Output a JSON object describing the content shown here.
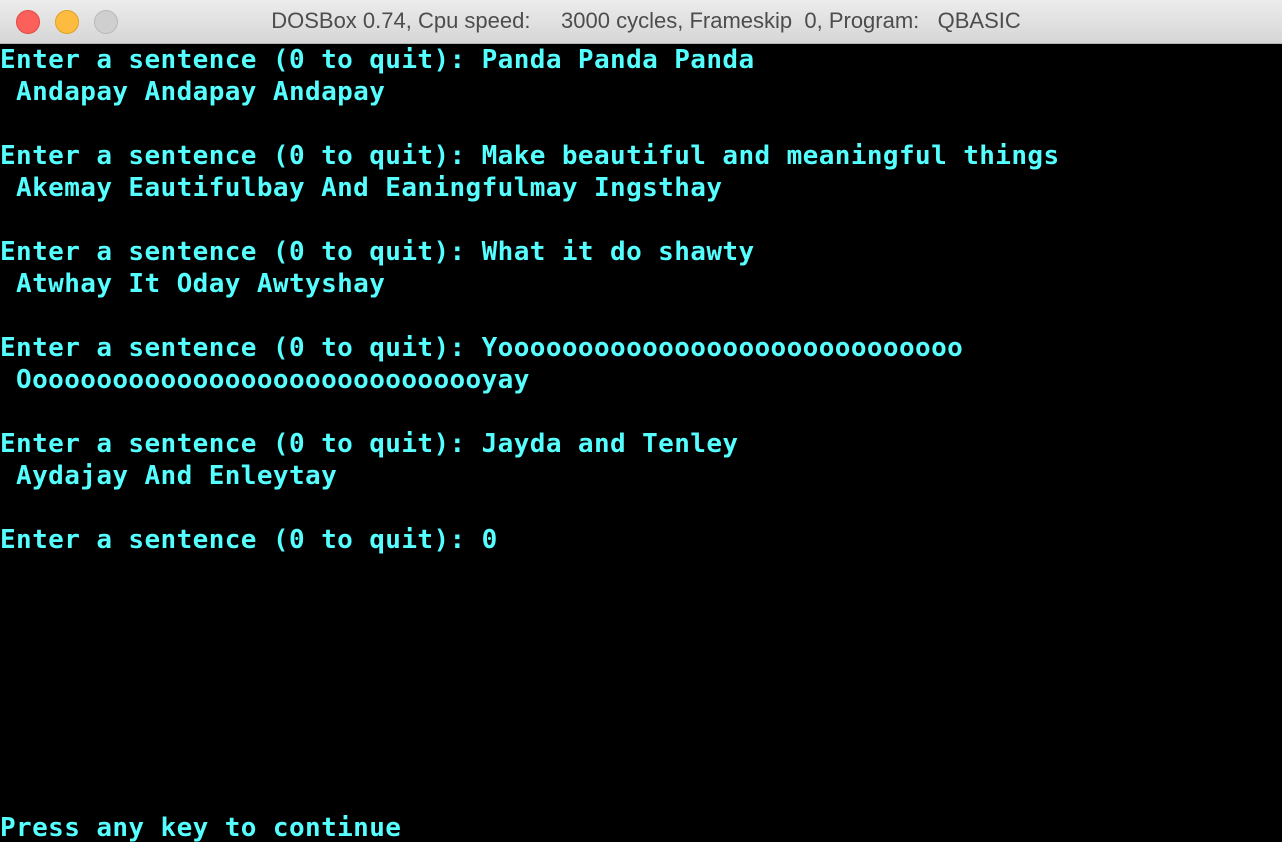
{
  "window": {
    "title": "DOSBox 0.74, Cpu speed:     3000 cycles, Frameskip  0, Program:   QBASIC"
  },
  "console": {
    "lines": [
      "Enter a sentence (0 to quit): Panda Panda Panda",
      " Andapay Andapay Andapay",
      "Enter a sentence (0 to quit): Make beautiful and meaningful things",
      " Akemay Eautifulbay And Eaningfulmay Ingsthay",
      "Enter a sentence (0 to quit): What it do shawty",
      " Atwhay It Oday Awtyshay",
      "Enter a sentence (0 to quit): Yooooooooooooooooooooooooooooo",
      " Oooooooooooooooooooooooooooooyay",
      "Enter a sentence (0 to quit): Jayda and Tenley",
      " Aydajay And Enleytay",
      "Enter a sentence (0 to quit): 0"
    ],
    "footer": "Press any key to continue"
  },
  "colors": {
    "text": "#55ffff",
    "background": "#000000"
  }
}
